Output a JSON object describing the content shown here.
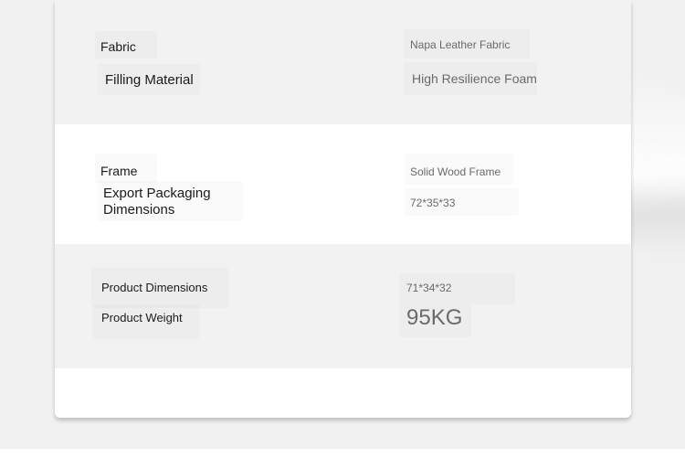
{
  "specs": {
    "fabric": {
      "label": "Fabric",
      "value": "Napa Leather Fabric"
    },
    "filling": {
      "label": "Filling Material",
      "value": "High Resilience Foam"
    },
    "frame": {
      "label": "Frame",
      "value": "Solid Wood Frame"
    },
    "packaging": {
      "label_line1": "Export Packaging",
      "label_line2": "Dimensions",
      "value": "72*35*33"
    },
    "product_dimensions": {
      "label": "Product Dimensions",
      "value": "71*34*32"
    },
    "product_weight": {
      "label": "Product Weight",
      "value": "95KG"
    }
  }
}
